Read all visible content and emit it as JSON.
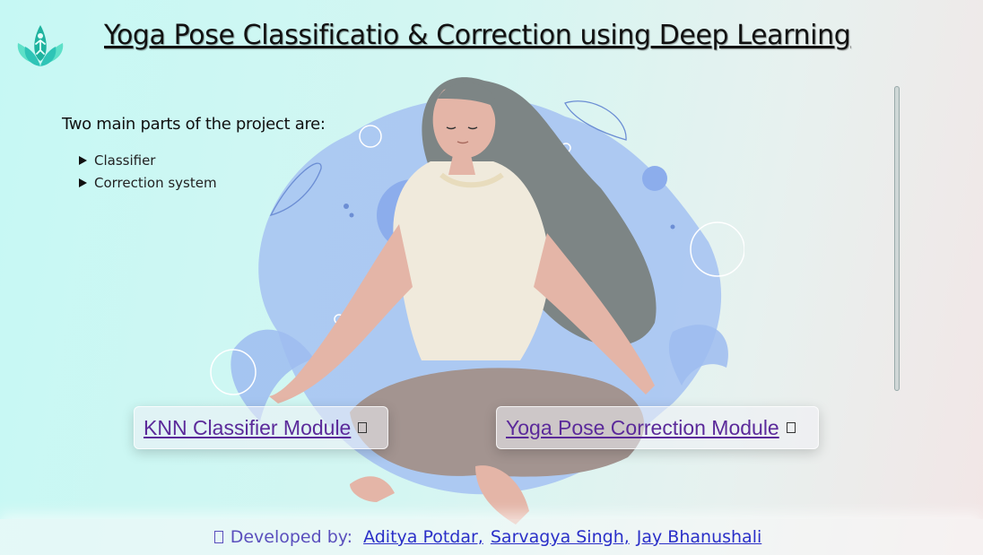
{
  "header": {
    "title": "Yoga Pose Classificatio & Correction using Deep Learning",
    "logo_icon": "lotus-yoga-icon"
  },
  "main": {
    "parts_heading": "Two main parts of the project are:",
    "parts": [
      "Classifier",
      "Correction system"
    ]
  },
  "modules": [
    {
      "label": "KNN Classifier Module",
      "icon": "external-link-icon"
    },
    {
      "label": "Yoga Pose Correction Module",
      "icon": "external-link-icon"
    }
  ],
  "footer": {
    "developed_by": "Developed by:",
    "developers": [
      "Aditya Potdar,",
      "Sarvagya Singh,",
      "Jay Bhanushali"
    ]
  },
  "colors": {
    "accent_teal": "#2ec4b6",
    "link_purple": "#5b2a9a",
    "footer_link": "#2a2fc8"
  }
}
